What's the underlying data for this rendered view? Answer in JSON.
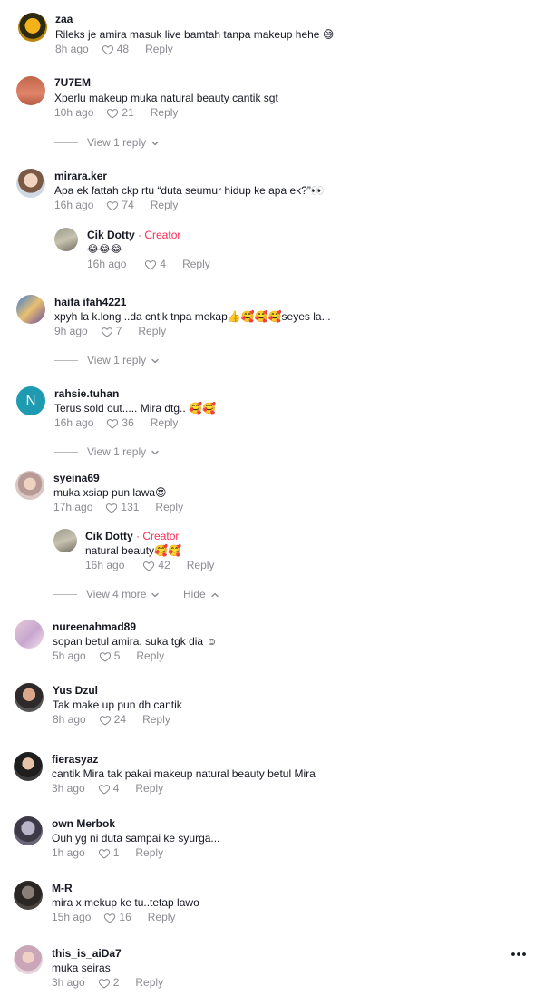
{
  "comments": [
    {
      "user": "zaa",
      "text": "Rileks je amira masuk live bamtah tanpa makeup hehe 😅",
      "time": "8h ago",
      "likes": "48",
      "reply": "Reply"
    },
    {
      "user": "7U7EM",
      "text": "Xperlu makeup muka natural beauty cantik sgt",
      "time": "10h ago",
      "likes": "21",
      "reply": "Reply",
      "view": "View 1 reply"
    },
    {
      "user": "mirara.ker",
      "text": "Apa ek fattah ckp rtu “duta seumur hidup ke apa ek?”👀",
      "time": "16h ago",
      "likes": "74",
      "reply": "Reply",
      "sub": {
        "user": "Cik Dotty",
        "creator": "· Creator",
        "text": "😂😂😂",
        "time": "16h ago",
        "likes": "4",
        "reply": "Reply"
      }
    },
    {
      "user": "haifa ifah4221",
      "text": "xpyh la k.long ..da cntik tnpa mekap👍🥰🥰🥰seyes la...",
      "time": "9h ago",
      "likes": "7",
      "reply": "Reply",
      "view": "View 1 reply"
    },
    {
      "user": "rahsie.tuhan",
      "avatar_letter": "N",
      "text": "Terus sold out..... Mira dtg.. 🥰🥰",
      "time": "16h ago",
      "likes": "36",
      "reply": "Reply",
      "view": "View 1 reply"
    },
    {
      "user": "syeina69",
      "text": "muka xsiap pun lawa😍",
      "time": "17h ago",
      "likes": "131",
      "reply": "Reply",
      "sub": {
        "user": "Cik Dotty",
        "creator": "· Creator",
        "text": "natural beauty🥰🥰",
        "time": "16h ago",
        "likes": "42",
        "reply": "Reply"
      },
      "view": "View 4 more",
      "hide": "Hide"
    },
    {
      "user": "nureenahmad89",
      "text": "sopan betul amira. suka tgk dia ☺",
      "time": "5h ago",
      "likes": "5",
      "reply": "Reply"
    },
    {
      "user": "Yus Dzul",
      "text": "Tak make up pun dh cantik",
      "time": "8h ago",
      "likes": "24",
      "reply": "Reply"
    },
    {
      "user": "fierasyaz",
      "text": "cantik Mira tak pakai makeup natural beauty betul Mira",
      "time": "3h ago",
      "likes": "4",
      "reply": "Reply"
    },
    {
      "user": "own Merbok",
      "text": "Ouh yg ni duta sampai ke syurga...",
      "time": "1h ago",
      "likes": "1",
      "reply": "Reply"
    },
    {
      "user": "M-R",
      "text": "mira x mekup ke tu..tetap lawo",
      "time": "15h ago",
      "likes": "16",
      "reply": "Reply"
    },
    {
      "user": "this_is_aiDa7",
      "text": "muka seiras",
      "time": "3h ago",
      "likes": "2",
      "reply": "Reply"
    }
  ],
  "icons": {
    "like": "heart-outline-icon",
    "expand": "chevron-down-icon",
    "collapse": "chevron-up-icon",
    "more": "more-horizontal-icon"
  },
  "colors": {
    "creator": "#fe2c55",
    "muted": "#8a8b91",
    "text": "#161823",
    "avatar_n": "#1e9bb0"
  }
}
